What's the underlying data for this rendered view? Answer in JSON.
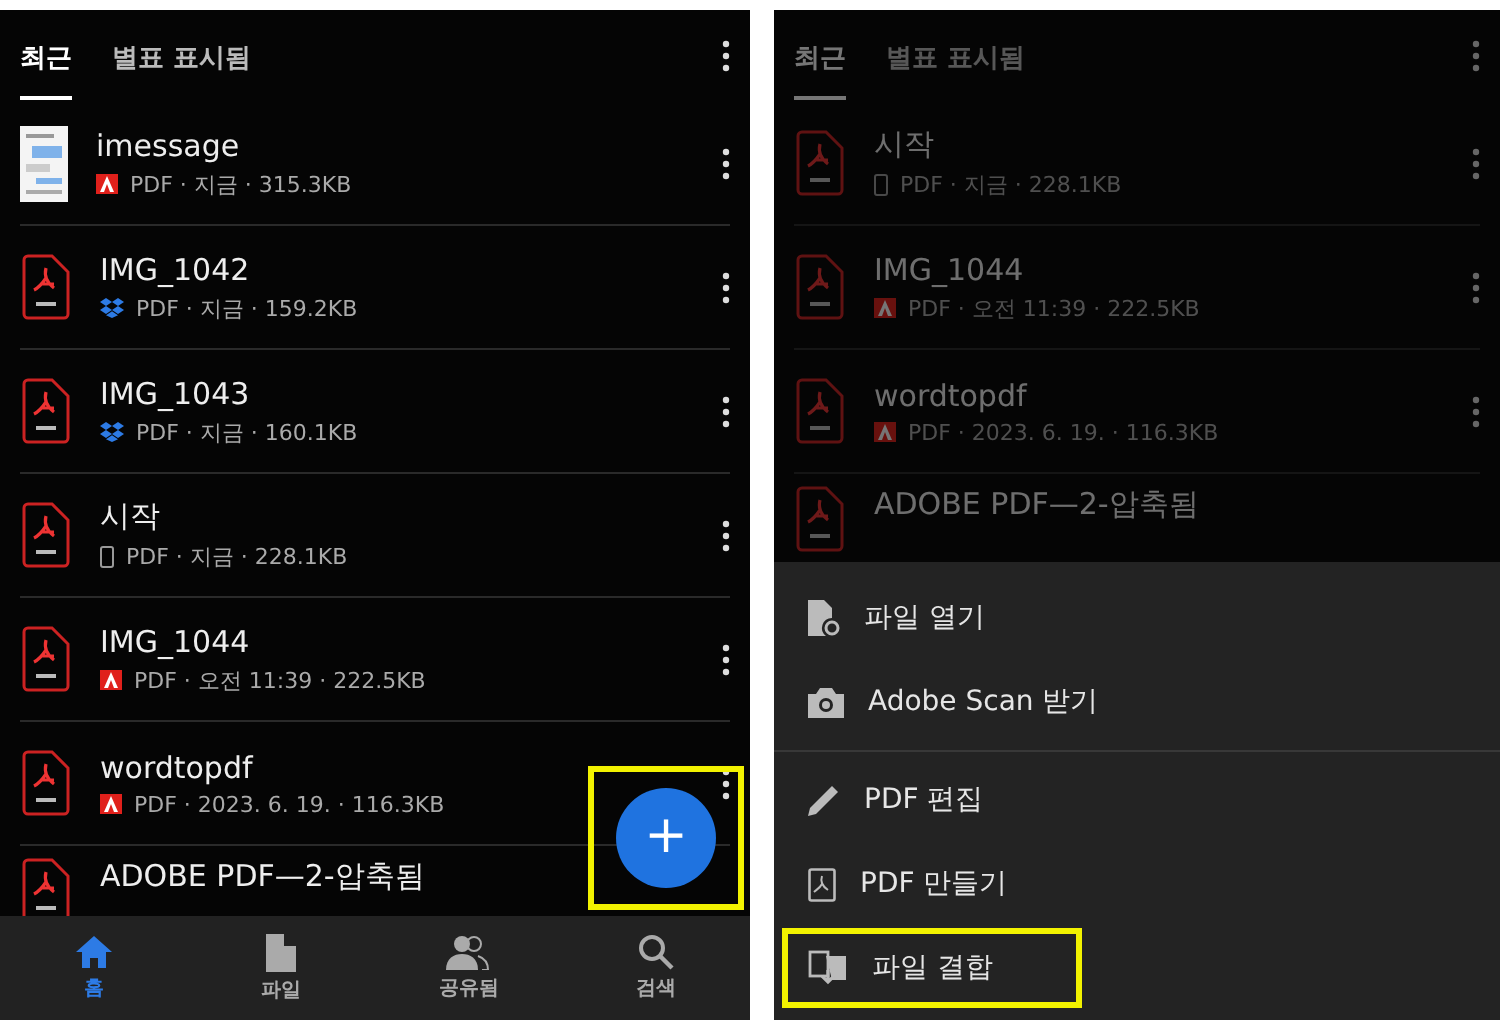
{
  "screens": [
    {
      "dimmed": false,
      "tabs": [
        {
          "label": "최근",
          "selected": true
        },
        {
          "label": "별표 표시됨",
          "selected": false
        }
      ],
      "files": [
        {
          "kind": "thumbnail",
          "name": "imessage",
          "badge": {
            "kind": "adobe"
          },
          "meta": "PDF · 지금 · 315.3KB"
        },
        {
          "kind": "pdf",
          "name": "IMG_1042",
          "badge": {
            "kind": "dropbox"
          },
          "meta": "PDF · 지금 · 159.2KB"
        },
        {
          "kind": "pdf",
          "name": "IMG_1043",
          "badge": {
            "kind": "dropbox"
          },
          "meta": "PDF · 지금 · 160.1KB"
        },
        {
          "kind": "pdf",
          "name": "시작",
          "badge": {
            "kind": "device"
          },
          "meta": "PDF · 지금 · 228.1KB"
        },
        {
          "kind": "pdf",
          "name": "IMG_1044",
          "badge": {
            "kind": "adobe"
          },
          "meta": "PDF · 오전 11:39 · 222.5KB"
        },
        {
          "kind": "pdf",
          "name": "wordtopdf",
          "badge": {
            "kind": "adobe"
          },
          "meta": "PDF · 2023. 6. 19. · 116.3KB"
        },
        {
          "kind": "pdf",
          "name": "ADOBE PDF—2-압축됨"
        }
      ],
      "fab": {
        "label": "+",
        "highlighted": true
      },
      "nav": [
        {
          "kind": "home",
          "label": "홈",
          "selected": true
        },
        {
          "kind": "file",
          "label": "파일",
          "selected": false
        },
        {
          "kind": "people",
          "label": "공유됨",
          "selected": false
        },
        {
          "kind": "search",
          "label": "검색",
          "selected": false
        }
      ]
    },
    {
      "dimmed": true,
      "tabs": [
        {
          "label": "최근",
          "selected": true
        },
        {
          "label": "별표 표시됨",
          "selected": false
        }
      ],
      "files": [
        {
          "kind": "pdf",
          "name": "시작",
          "badge": {
            "kind": "device"
          },
          "meta": "PDF · 지금 · 228.1KB"
        },
        {
          "kind": "pdf",
          "name": "IMG_1044",
          "badge": {
            "kind": "adobe"
          },
          "meta": "PDF · 오전 11:39 · 222.5KB"
        },
        {
          "kind": "pdf",
          "name": "wordtopdf",
          "badge": {
            "kind": "adobe"
          },
          "meta": "PDF · 2023. 6. 19. · 116.3KB"
        },
        {
          "kind": "pdf",
          "name": "ADOBE PDF—2-압축됨"
        }
      ],
      "menu": [
        [
          {
            "kind": "open",
            "label": "파일 열기",
            "highlighted": false
          },
          {
            "kind": "camera",
            "label": "Adobe Scan 받기",
            "highlighted": false
          }
        ],
        [
          {
            "kind": "pencil",
            "label": "PDF 편집",
            "highlighted": false
          },
          {
            "kind": "pdf",
            "label": "PDF 만들기",
            "highlighted": false
          },
          {
            "kind": "combine",
            "label": "파일 결합",
            "highlighted": true
          }
        ]
      ]
    }
  ]
}
